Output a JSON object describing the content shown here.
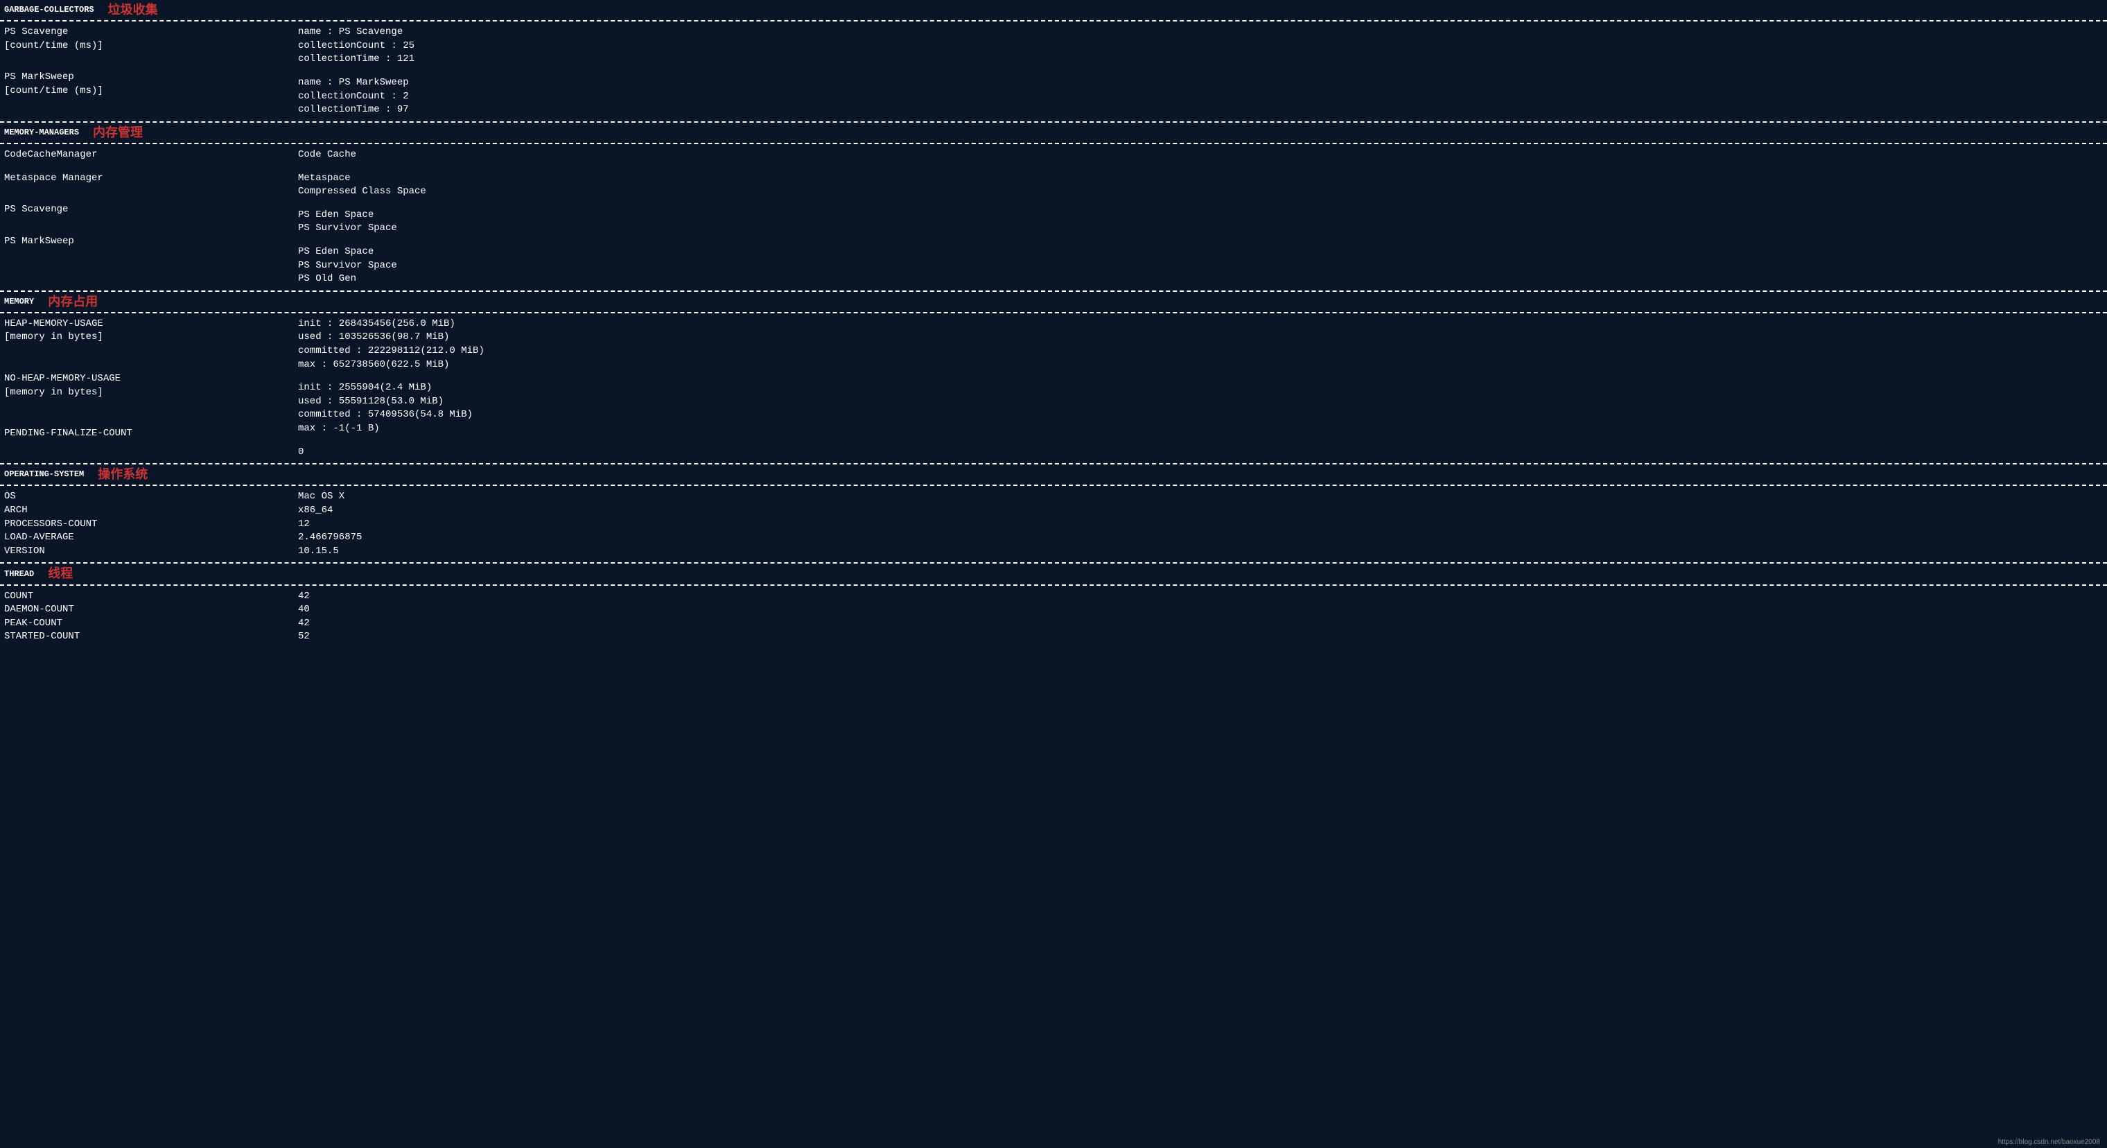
{
  "watermark": "https://blog.csdn.net/baoxue2008",
  "sections": {
    "gc": {
      "title": "GARBAGE-COLLECTORS",
      "annotation": "垃圾收集",
      "items": [
        {
          "labels": [
            "PS Scavenge",
            "[count/time (ms)]"
          ],
          "values": [
            "name : PS Scavenge",
            "collectionCount : 25",
            "collectionTime : 121"
          ]
        },
        {
          "labels": [
            "PS MarkSweep",
            "[count/time (ms)]"
          ],
          "values": [
            "name : PS MarkSweep",
            "collectionCount : 2",
            "collectionTime : 97"
          ]
        }
      ]
    },
    "mm": {
      "title": "MEMORY-MANAGERS",
      "annotation": "内存管理",
      "items": [
        {
          "labels": [
            "CodeCacheManager"
          ],
          "values": [
            "Code Cache"
          ]
        },
        {
          "labels": [
            "Metaspace Manager"
          ],
          "values": [
            "Metaspace",
            "Compressed Class Space"
          ]
        },
        {
          "labels": [
            "PS Scavenge"
          ],
          "values": [
            "PS Eden Space",
            "PS Survivor Space"
          ]
        },
        {
          "labels": [
            "PS MarkSweep"
          ],
          "values": [
            "PS Eden Space",
            "PS Survivor Space",
            "PS Old Gen"
          ]
        }
      ]
    },
    "memory": {
      "title": "MEMORY",
      "annotation": "内存占用",
      "items": [
        {
          "labels": [
            "HEAP-MEMORY-USAGE",
            "[memory in bytes]"
          ],
          "values": [
            "init : 268435456(256.0 MiB)",
            "used : 103526536(98.7 MiB)",
            "committed : 222298112(212.0 MiB)",
            "max : 652738560(622.5 MiB)"
          ]
        },
        {
          "labels": [
            "NO-HEAP-MEMORY-USAGE",
            "[memory in bytes]"
          ],
          "values": [
            "init : 2555904(2.4 MiB)",
            "used : 55591128(53.0 MiB)",
            "committed : 57409536(54.8 MiB)",
            "max : -1(-1 B)"
          ]
        },
        {
          "labels": [
            "PENDING-FINALIZE-COUNT"
          ],
          "values": [
            "0"
          ]
        }
      ]
    },
    "os": {
      "title": "OPERATING-SYSTEM",
      "annotation": "操作系统",
      "items": [
        {
          "labels": [
            "OS",
            "ARCH",
            "PROCESSORS-COUNT",
            "LOAD-AVERAGE",
            "VERSION"
          ],
          "values": [
            "Mac OS X",
            "x86_64",
            "12",
            "2.466796875",
            "10.15.5"
          ]
        }
      ]
    },
    "thread": {
      "title": "THREAD",
      "annotation": "线程",
      "items": [
        {
          "labels": [
            "COUNT",
            "DAEMON-COUNT",
            "PEAK-COUNT",
            "STARTED-COUNT"
          ],
          "values": [
            "42",
            "40",
            "42",
            "52"
          ]
        }
      ]
    }
  }
}
